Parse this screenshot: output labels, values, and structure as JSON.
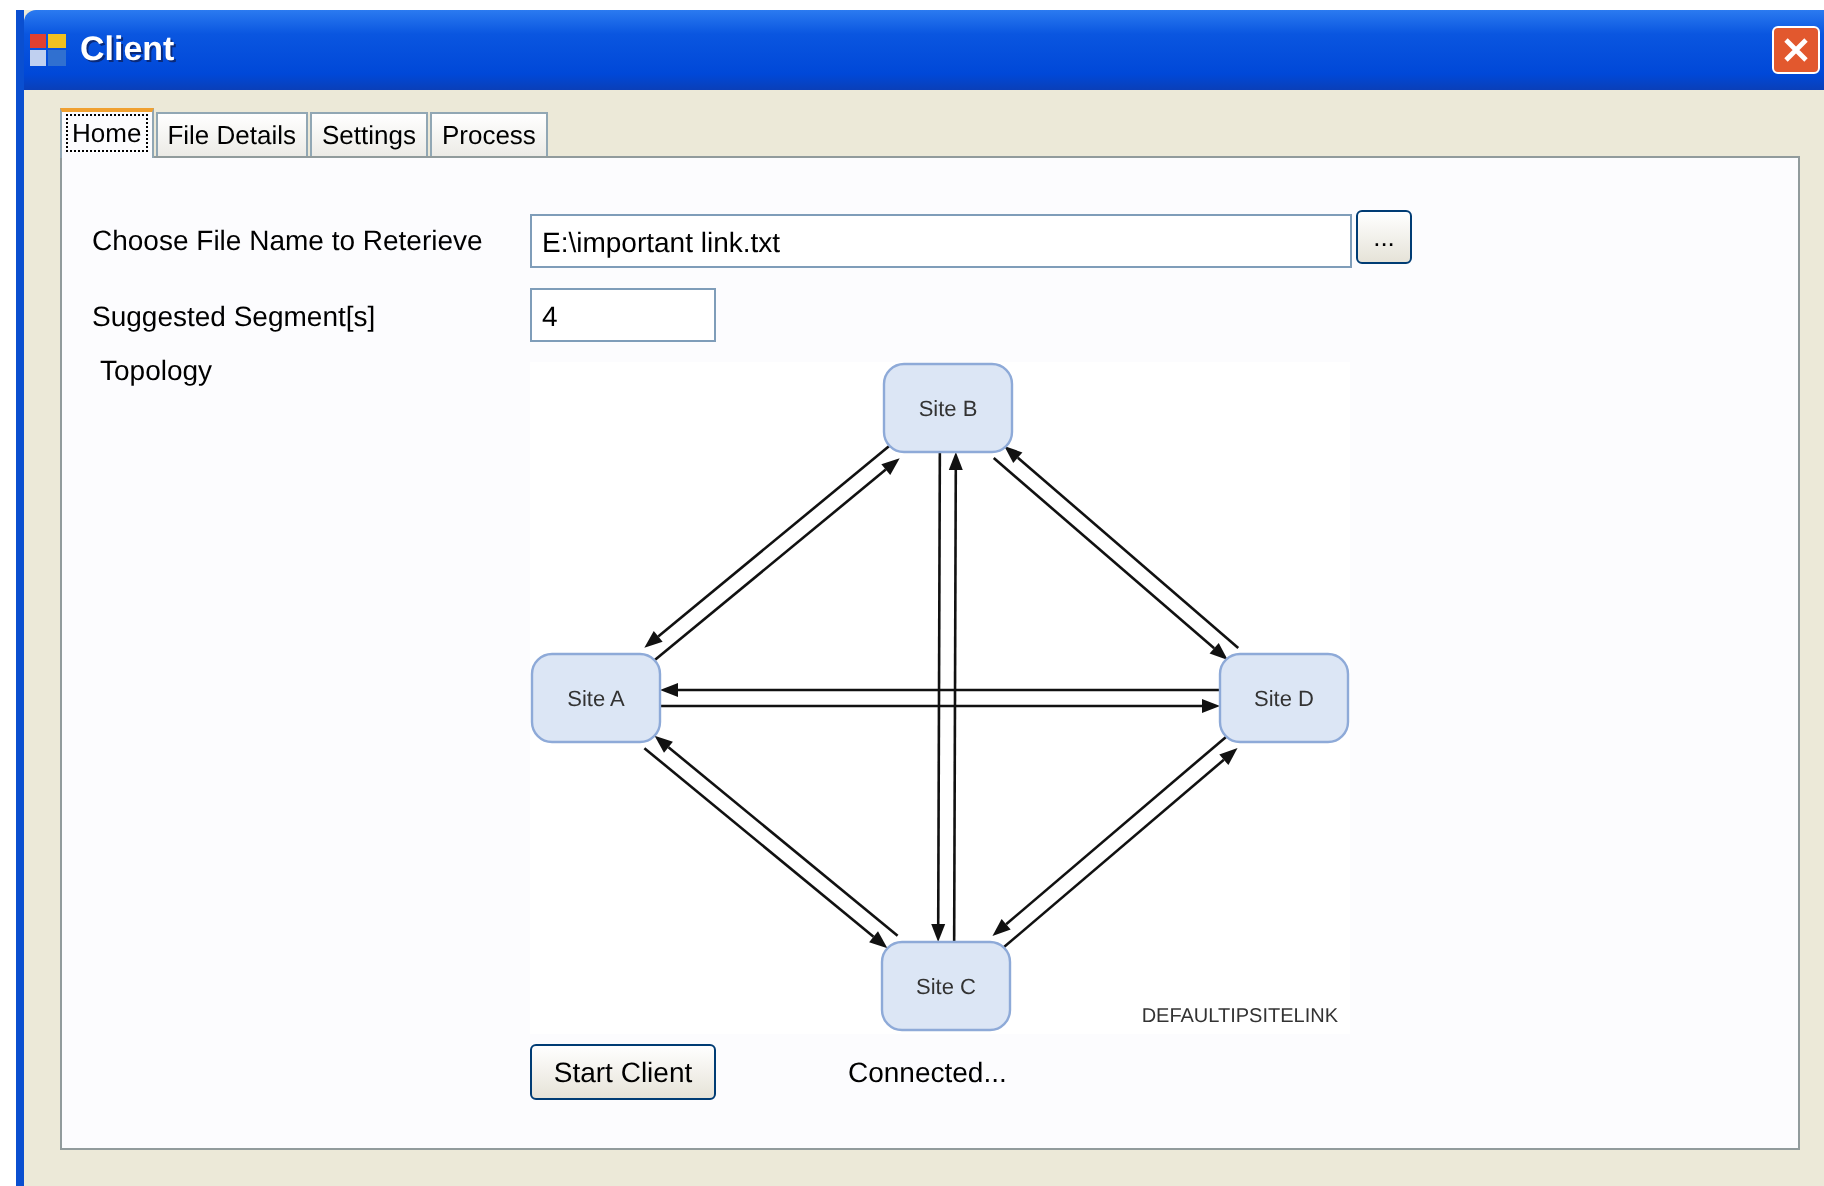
{
  "window": {
    "title": "Client"
  },
  "tabs": [
    {
      "label": "Home",
      "selected": true
    },
    {
      "label": "File Details",
      "selected": false
    },
    {
      "label": "Settings",
      "selected": false
    },
    {
      "label": "Process",
      "selected": false
    }
  ],
  "form": {
    "file_label": "Choose File Name to Reterieve",
    "file_value": "E:\\important link.txt",
    "browse_button": "...",
    "segments_label": "Suggested Segment[s]",
    "segments_value": "4",
    "topology_label": "Topology"
  },
  "topology": {
    "nodes": [
      {
        "label": "Site B"
      },
      {
        "label": "Site A"
      },
      {
        "label": "Site D"
      },
      {
        "label": "Site C"
      }
    ],
    "caption": "DEFAULTIPSITELINK"
  },
  "start_button": "Start Client",
  "status": "Connected..."
}
